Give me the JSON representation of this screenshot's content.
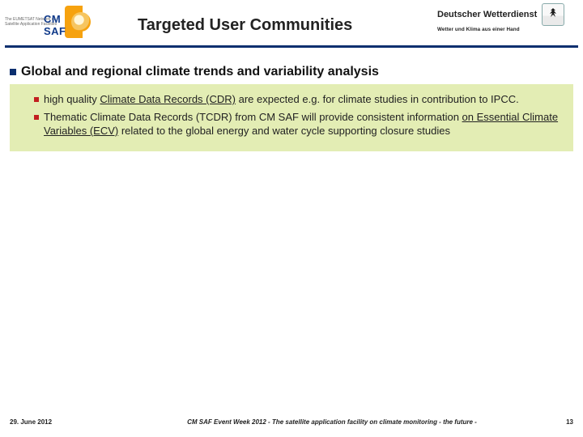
{
  "header": {
    "left_logo_small_text": "The EUMETSAT\nNetwork of\nSatellite Application\nFacilities",
    "left_logo_label": "CM SAF",
    "title": "Targeted User Communities",
    "dwd_name": "Deutscher Wetterdienst",
    "dwd_tagline": "Wetter und Klima aus einer Hand"
  },
  "content": {
    "heading": "Global and regional climate trends and variability analysis",
    "bullets": [
      {
        "pre": "high quality ",
        "u1": "Climate Data Records (CDR)",
        "post": " are expected e.g. for climate studies in contribution to IPCC."
      },
      {
        "pre": "Thematic Climate Data Records (TCDR)",
        "mid": " from CM SAF will provide consistent information ",
        "u1": "on Essential Climate Variables (ECV)",
        "post": " related to the global energy and water cycle supporting closure studies"
      }
    ]
  },
  "footer": {
    "date": "29. June 2012",
    "caption": "CM SAF Event Week 2012 - The satellite application facility on climate monitoring - the future -",
    "page": "13"
  }
}
